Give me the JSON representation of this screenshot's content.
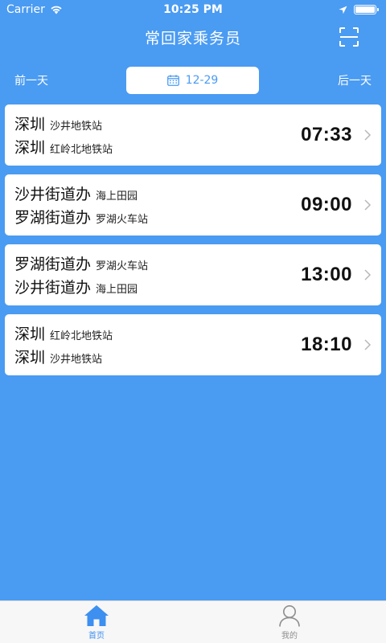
{
  "status_bar": {
    "carrier": "Carrier",
    "time": "10:25 PM",
    "battery_level": 1.0
  },
  "header": {
    "title": "常回家乘务员",
    "scan_icon": "scan-icon"
  },
  "date_nav": {
    "prev_label": "前一天",
    "date": "12-29",
    "next_label": "后一天",
    "calendar_icon": "calendar-icon"
  },
  "trips": [
    {
      "from_city": "深圳",
      "from_station": "沙井地铁站",
      "to_city": "深圳",
      "to_station": "红岭北地铁站",
      "time": "07:33"
    },
    {
      "from_city": "沙井街道办",
      "from_station": "海上田园",
      "to_city": "罗湖街道办",
      "to_station": "罗湖火车站",
      "time": "09:00"
    },
    {
      "from_city": "罗湖街道办",
      "from_station": "罗湖火车站",
      "to_city": "沙井街道办",
      "to_station": "海上田园",
      "time": "13:00"
    },
    {
      "from_city": "深圳",
      "from_station": "红岭北地铁站",
      "to_city": "深圳",
      "to_station": "沙井地铁站",
      "time": "18:10"
    }
  ],
  "tabs": [
    {
      "label": "首页",
      "icon": "home-icon",
      "active": true
    },
    {
      "label": "我的",
      "icon": "user-icon",
      "active": false
    }
  ],
  "colors": {
    "primary": "#4a9bf2",
    "card": "#ffffff",
    "tab_active": "#3d8ff0",
    "tab_inactive": "#8e8e8e"
  }
}
